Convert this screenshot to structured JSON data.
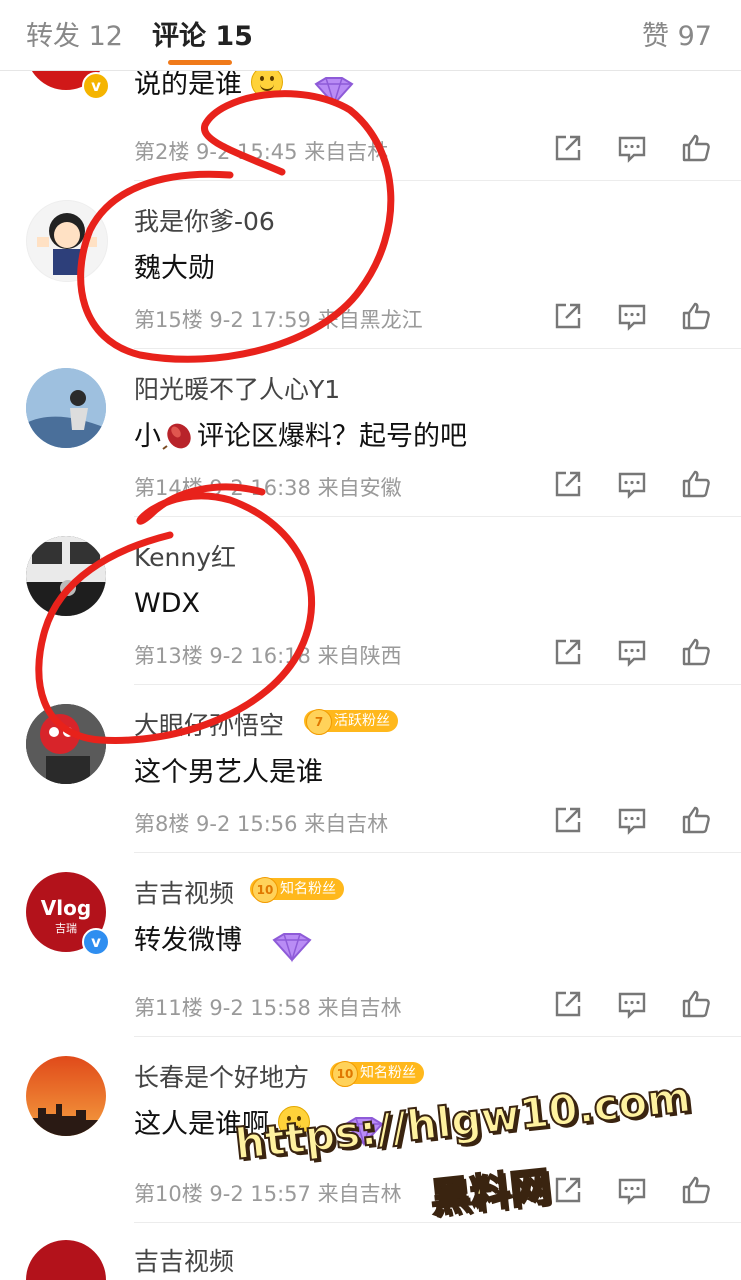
{
  "tabs": {
    "repost": "转发 12",
    "comments": "评论 15",
    "likes": "赞 97"
  },
  "comments": [
    {
      "text": "说的是谁",
      "meta": "第2楼  9-2 15:45  来自吉林"
    },
    {
      "name": "我是你爹-06",
      "text": "魏大勋",
      "meta": "第15楼  9-2 17:59  来自黑龙江"
    },
    {
      "name": "阳光暖不了人心Y1",
      "text_pre": "小",
      "text_post": "评论区爆料？起号的吧",
      "meta": "第14楼  9-2 16:38  来自安徽"
    },
    {
      "name": "Kenny红",
      "text": "WDX",
      "meta": "第13楼  9-2 16:18  来自陕西"
    },
    {
      "name": "大眼仔孙悟空",
      "badge_level": "7",
      "badge_label": "活跃粉丝",
      "text": "这个男艺人是谁",
      "meta": "第8楼  9-2 15:56  来自吉林"
    },
    {
      "name": "吉吉视频",
      "avatar_text": "Vlog",
      "avatar_sub": "吉瑞",
      "badge_level": "10",
      "badge_label": "知名粉丝",
      "text": "转发微博",
      "meta": "第11楼  9-2 15:58  来自吉林"
    },
    {
      "name": "长春是个好地方",
      "badge_level": "10",
      "badge_label": "知名粉丝",
      "text": "这人是谁啊",
      "meta": "第10楼  9-2 15:57  来自吉林"
    },
    {
      "name": "吉吉视频"
    }
  ],
  "watermark": {
    "url": "https://hlgw10.com",
    "label": "黑料网"
  },
  "icons": [
    "share-icon",
    "comment-icon",
    "like-icon",
    "verified-icon",
    "diamond-icon",
    "smile-emoji-icon"
  ],
  "colors": {
    "accent": "#f07a1a",
    "verified": "#2f8ef0",
    "fan_badge": "#ffb81c",
    "annotation": "#e8221b"
  }
}
